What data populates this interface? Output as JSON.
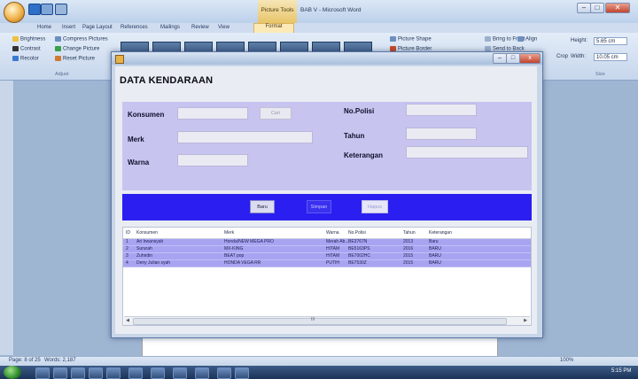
{
  "word": {
    "context_tab": "Picture Tools",
    "doc_title": "BAB V - Microsoft Word",
    "tabs": [
      "Home",
      "Insert",
      "Page Layout",
      "References",
      "Mailings",
      "Review",
      "View",
      "Format"
    ],
    "ribbon": {
      "brightness": "Brightness",
      "contrast": "Contrast",
      "recolor": "Recolor",
      "compress": "Compress Pictures",
      "change": "Change Picture",
      "reset": "Reset Picture",
      "adjust_group": "Adjust",
      "picture_shape": "Picture Shape",
      "picture_border": "Picture Border",
      "bring_front": "Bring to Front",
      "send_back": "Send to Back",
      "align": "Align",
      "crop": "Crop",
      "height_label": "Height:",
      "height_value": "5.65 cm",
      "width_label": "Width:",
      "width_value": "10.05 cm",
      "size_group": "Size"
    },
    "status": {
      "page": "Page: 8 of 25",
      "words": "Words: 2,187",
      "zoom": "100%"
    },
    "clock": "5:15 PM"
  },
  "dialog": {
    "heading": "DATA KENDARAAN",
    "close_glyph": "x",
    "labels": {
      "konsumen": "Konsumen",
      "merk": "Merk",
      "warna": "Warna",
      "nopolisi": "No.Polisi",
      "tahun": "Tahun",
      "keterangan": "Keterangan"
    },
    "fields": {
      "konsumen": "",
      "merk": "",
      "warna": "",
      "nopolisi": "",
      "tahun": "",
      "keterangan": ""
    },
    "buttons": {
      "cari": "Cari",
      "baru": "Baru",
      "simpan": "Simpan",
      "hapus": "Hapus"
    },
    "table": {
      "headers": [
        "ID",
        "Konsumen",
        "Merk",
        "Warna",
        "No.Polisi",
        "Tahun",
        "Keterangan"
      ],
      "rows": [
        [
          "1",
          "Ari Irwansyah",
          "Honda/NEW MEGA PRO",
          "Merah Ab...",
          "BE3767N",
          "2013",
          "Baru"
        ],
        [
          "2",
          "Sururah",
          "MX-KING",
          "HITAM",
          "BE5163PS",
          "2016",
          "BARU"
        ],
        [
          "3",
          "Zuhridin",
          "BEAT pop",
          "HITAM",
          "BE7002HC",
          "2015",
          "BARU"
        ],
        [
          "4",
          "Deny Julian syah",
          "HONDA VEGA RR",
          "PUTIH",
          "BE7530Z",
          "2015",
          "BARU"
        ]
      ],
      "scroll_mark": "III"
    }
  },
  "colors": {
    "form_panel": "#c7c4f0",
    "button_panel": "#2a1ff0",
    "row_fill": "#a9a4f1"
  }
}
